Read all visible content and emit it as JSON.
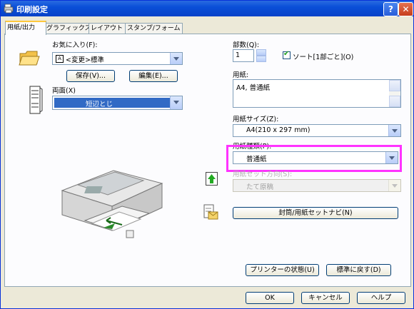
{
  "window": {
    "title": "印刷設定"
  },
  "tabs": [
    "用紙/出力",
    "グラフィックス",
    "レイアウト",
    "スタンプ/フォーム"
  ],
  "favorites": {
    "label": "お気に入り(F):",
    "value": "<変更>標準",
    "save_label": "保存(V)...",
    "edit_label": "編集(E)..."
  },
  "duplex": {
    "label": "両面(X)",
    "value": "短辺とじ"
  },
  "copies": {
    "label": "部数(Q):",
    "value": "1",
    "collate_label": "ソート[1部ごと](O)"
  },
  "paper": {
    "label": "用紙:",
    "value": "A4, 普通紙"
  },
  "paper_size": {
    "label": "用紙サイズ(Z):",
    "value": "A4(210 x 297 mm)"
  },
  "paper_type": {
    "label": "用紙種類(P):",
    "value": "普通紙"
  },
  "paper_orientation": {
    "label": "用紙セット方向(S):",
    "value": "たて原稿"
  },
  "envelope_btn": "封筒/用紙セットナビ(N)",
  "printer_status_btn": "プリンターの状態(U)",
  "restore_default_btn": "標準に戻す(D)",
  "footer": {
    "ok": "OK",
    "cancel": "キャンセル",
    "help": "ヘルプ"
  },
  "colors": {
    "highlight": "#ff33ff",
    "title_bar": "#0a4fd8"
  }
}
